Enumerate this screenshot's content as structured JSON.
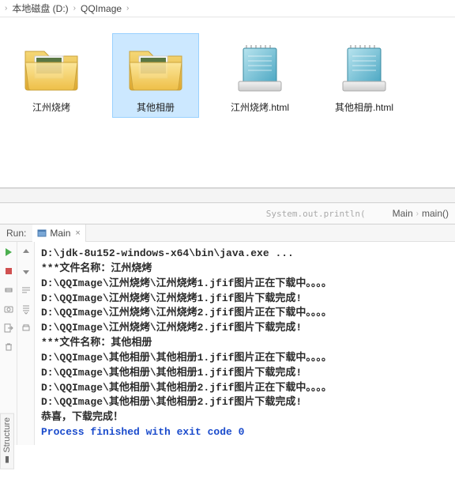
{
  "breadcrumb": {
    "drive": "本地磁盘 (D:)",
    "folder": "QQImage"
  },
  "files": [
    {
      "label": "江州烧烤",
      "type": "folder-photos",
      "selected": false
    },
    {
      "label": "其他相册",
      "type": "folder-photos",
      "selected": true
    },
    {
      "label": "江州烧烤.html",
      "type": "text-file",
      "selected": false
    },
    {
      "label": "其他相册.html",
      "type": "text-file",
      "selected": false
    }
  ],
  "ide_breadcrumb": {
    "hint": "System.out.println(",
    "a": "Main",
    "b": "main()"
  },
  "run_tool": {
    "label": "Run:",
    "tab": "Main"
  },
  "side_label": "Structure",
  "console_lines": [
    {
      "cls": "bold",
      "text": "D:\\jdk-8u152-windows-x64\\bin\\java.exe ..."
    },
    {
      "cls": "bold",
      "text": "***文件名称：江州烧烤"
    },
    {
      "cls": "bold",
      "text": "D:\\QQImage\\江州烧烤\\江州烧烤1.jfif图片正在下载中。。。。"
    },
    {
      "cls": "bold",
      "text": "D:\\QQImage\\江州烧烤\\江州烧烤1.jfif图片下载完成!"
    },
    {
      "cls": "bold",
      "text": "D:\\QQImage\\江州烧烤\\江州烧烤2.jfif图片正在下载中。。。。"
    },
    {
      "cls": "bold",
      "text": "D:\\QQImage\\江州烧烤\\江州烧烤2.jfif图片下载完成!"
    },
    {
      "cls": "bold",
      "text": "***文件名称：其他相册"
    },
    {
      "cls": "bold",
      "text": "D:\\QQImage\\其他相册\\其他相册1.jfif图片正在下载中。。。。"
    },
    {
      "cls": "bold",
      "text": "D:\\QQImage\\其他相册\\其他相册1.jfif图片下载完成!"
    },
    {
      "cls": "bold",
      "text": "D:\\QQImage\\其他相册\\其他相册2.jfif图片正在下载中。。。。"
    },
    {
      "cls": "bold",
      "text": "D:\\QQImage\\其他相册\\其他相册2.jfif图片下载完成!"
    },
    {
      "cls": "bold",
      "text": "恭喜，下载完成！"
    },
    {
      "cls": "",
      "text": ""
    },
    {
      "cls": "blue",
      "text": "Process finished with exit code 0"
    }
  ]
}
